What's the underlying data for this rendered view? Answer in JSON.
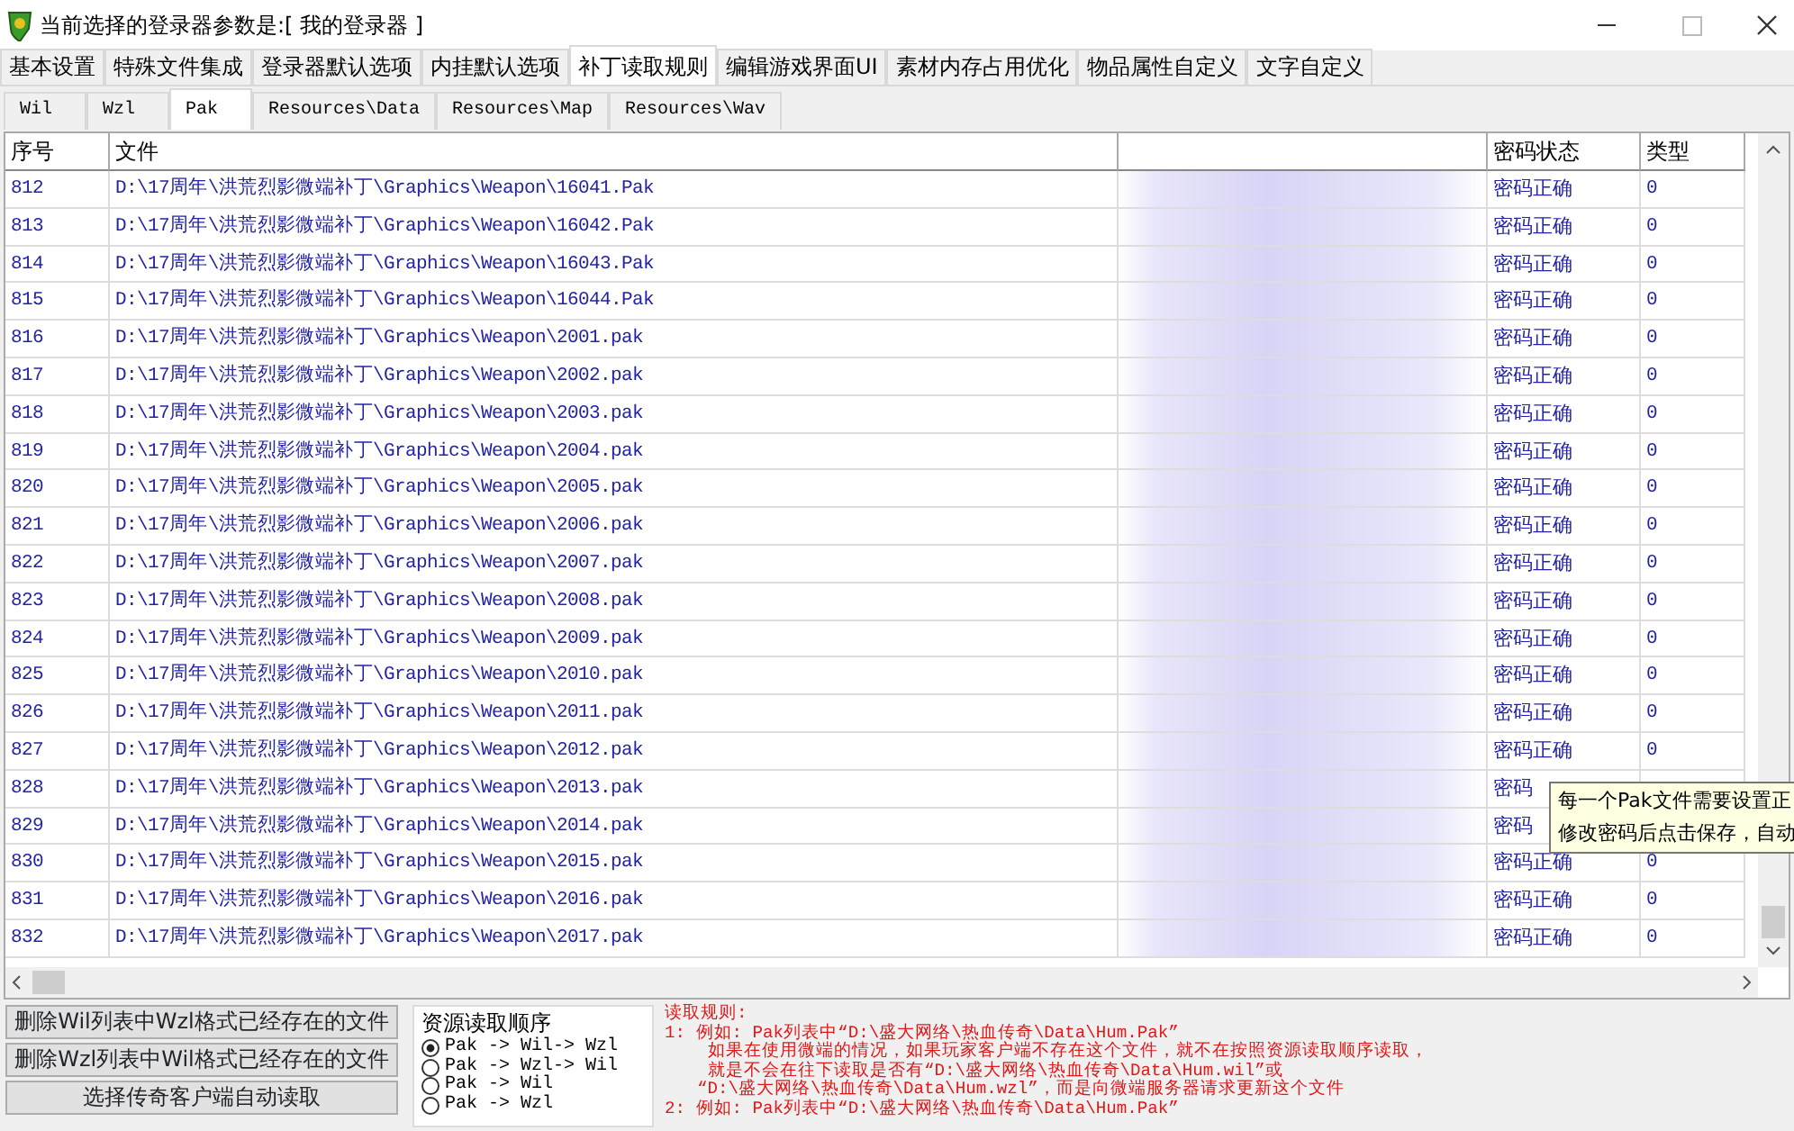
{
  "window": {
    "title": "当前选择的登录器参数是:[ 我的登录器 ]"
  },
  "tabs": [
    {
      "label": "基本设置",
      "selected": false
    },
    {
      "label": "特殊文件集成",
      "selected": false
    },
    {
      "label": "登录器默认选项",
      "selected": false
    },
    {
      "label": "内挂默认选项",
      "selected": false
    },
    {
      "label": "补丁读取规则",
      "selected": true
    },
    {
      "label": "编辑游戏界面UI",
      "selected": false
    },
    {
      "label": "素材内存占用优化",
      "selected": false
    },
    {
      "label": "物品属性自定义",
      "selected": false
    },
    {
      "label": "文字自定义",
      "selected": false
    }
  ],
  "subtabs": [
    {
      "label": "Wil",
      "selected": false
    },
    {
      "label": "Wzl",
      "selected": false
    },
    {
      "label": "Pak",
      "selected": true
    },
    {
      "label": "Resources\\Data",
      "selected": false
    },
    {
      "label": "Resources\\Map",
      "selected": false
    },
    {
      "label": "Resources\\Wav",
      "selected": false
    }
  ],
  "table": {
    "columns": [
      "序号",
      "文件",
      "密码状态",
      "类型"
    ],
    "rows": [
      {
        "no": "812",
        "file": "D:\\17周年\\洪荒烈影微端补丁\\Graphics\\Weapon\\16041.Pak",
        "status": "密码正确",
        "type": "0"
      },
      {
        "no": "813",
        "file": "D:\\17周年\\洪荒烈影微端补丁\\Graphics\\Weapon\\16042.Pak",
        "status": "密码正确",
        "type": "0"
      },
      {
        "no": "814",
        "file": "D:\\17周年\\洪荒烈影微端补丁\\Graphics\\Weapon\\16043.Pak",
        "status": "密码正确",
        "type": "0"
      },
      {
        "no": "815",
        "file": "D:\\17周年\\洪荒烈影微端补丁\\Graphics\\Weapon\\16044.Pak",
        "status": "密码正确",
        "type": "0"
      },
      {
        "no": "816",
        "file": "D:\\17周年\\洪荒烈影微端补丁\\Graphics\\Weapon\\2001.pak",
        "status": "密码正确",
        "type": "0"
      },
      {
        "no": "817",
        "file": "D:\\17周年\\洪荒烈影微端补丁\\Graphics\\Weapon\\2002.pak",
        "status": "密码正确",
        "type": "0"
      },
      {
        "no": "818",
        "file": "D:\\17周年\\洪荒烈影微端补丁\\Graphics\\Weapon\\2003.pak",
        "status": "密码正确",
        "type": "0"
      },
      {
        "no": "819",
        "file": "D:\\17周年\\洪荒烈影微端补丁\\Graphics\\Weapon\\2004.pak",
        "status": "密码正确",
        "type": "0"
      },
      {
        "no": "820",
        "file": "D:\\17周年\\洪荒烈影微端补丁\\Graphics\\Weapon\\2005.pak",
        "status": "密码正确",
        "type": "0"
      },
      {
        "no": "821",
        "file": "D:\\17周年\\洪荒烈影微端补丁\\Graphics\\Weapon\\2006.pak",
        "status": "密码正确",
        "type": "0"
      },
      {
        "no": "822",
        "file": "D:\\17周年\\洪荒烈影微端补丁\\Graphics\\Weapon\\2007.pak",
        "status": "密码正确",
        "type": "0"
      },
      {
        "no": "823",
        "file": "D:\\17周年\\洪荒烈影微端补丁\\Graphics\\Weapon\\2008.pak",
        "status": "密码正确",
        "type": "0"
      },
      {
        "no": "824",
        "file": "D:\\17周年\\洪荒烈影微端补丁\\Graphics\\Weapon\\2009.pak",
        "status": "密码正确",
        "type": "0"
      },
      {
        "no": "825",
        "file": "D:\\17周年\\洪荒烈影微端补丁\\Graphics\\Weapon\\2010.pak",
        "status": "密码正确",
        "type": "0"
      },
      {
        "no": "826",
        "file": "D:\\17周年\\洪荒烈影微端补丁\\Graphics\\Weapon\\2011.pak",
        "status": "密码正确",
        "type": "0"
      },
      {
        "no": "827",
        "file": "D:\\17周年\\洪荒烈影微端补丁\\Graphics\\Weapon\\2012.pak",
        "status": "密码正确",
        "type": "0"
      },
      {
        "no": "828",
        "file": "D:\\17周年\\洪荒烈影微端补丁\\Graphics\\Weapon\\2013.pak",
        "status": "密码"
      },
      {
        "no": "829",
        "file": "D:\\17周年\\洪荒烈影微端补丁\\Graphics\\Weapon\\2014.pak",
        "status": "密码"
      },
      {
        "no": "830",
        "file": "D:\\17周年\\洪荒烈影微端补丁\\Graphics\\Weapon\\2015.pak",
        "status": "密码正确",
        "type": "0"
      },
      {
        "no": "831",
        "file": "D:\\17周年\\洪荒烈影微端补丁\\Graphics\\Weapon\\2016.pak",
        "status": "密码正确",
        "type": "0"
      },
      {
        "no": "832",
        "file": "D:\\17周年\\洪荒烈影微端补丁\\Graphics\\Weapon\\2017.pak",
        "status": "密码正确",
        "type": "0"
      }
    ]
  },
  "tooltip": [
    "每一个Pak文件需要设置正",
    "修改密码后点击保存，自动"
  ],
  "buttons": [
    "删除Wil列表中Wzl格式已经存在的文件",
    "删除Wzl列表中Wil格式已经存在的文件",
    "选择传奇客户端自动读取"
  ],
  "read_order": {
    "title": "资源读取顺序",
    "options": [
      {
        "label": "Pak -> Wil-> Wzl",
        "selected": true
      },
      {
        "label": "Pak -> Wzl-> Wil",
        "selected": false
      },
      {
        "label": "Pak -> Wil",
        "selected": false
      },
      {
        "label": "Pak -> Wzl",
        "selected": false
      }
    ]
  },
  "rules": [
    "读取规则:",
    "1: 例如: Pak列表中“D:\\盛大网络\\热血传奇\\Data\\Hum.Pak”",
    "如果在使用微端的情况，如果玩家客户端不存在这个文件，就不在按照资源读取顺序读取，",
    "就是不会在往下读取是否有“D:\\盛大网络\\热血传奇\\Data\\Hum.wil”或",
    "“D:\\盛大网络\\热血传奇\\Data\\Hum.wzl”，而是向微端服务器请求更新这个文件",
    "2: 例如: Pak列表中“D:\\盛大网络\\热血传奇\\Data\\Hum.Pak”"
  ]
}
